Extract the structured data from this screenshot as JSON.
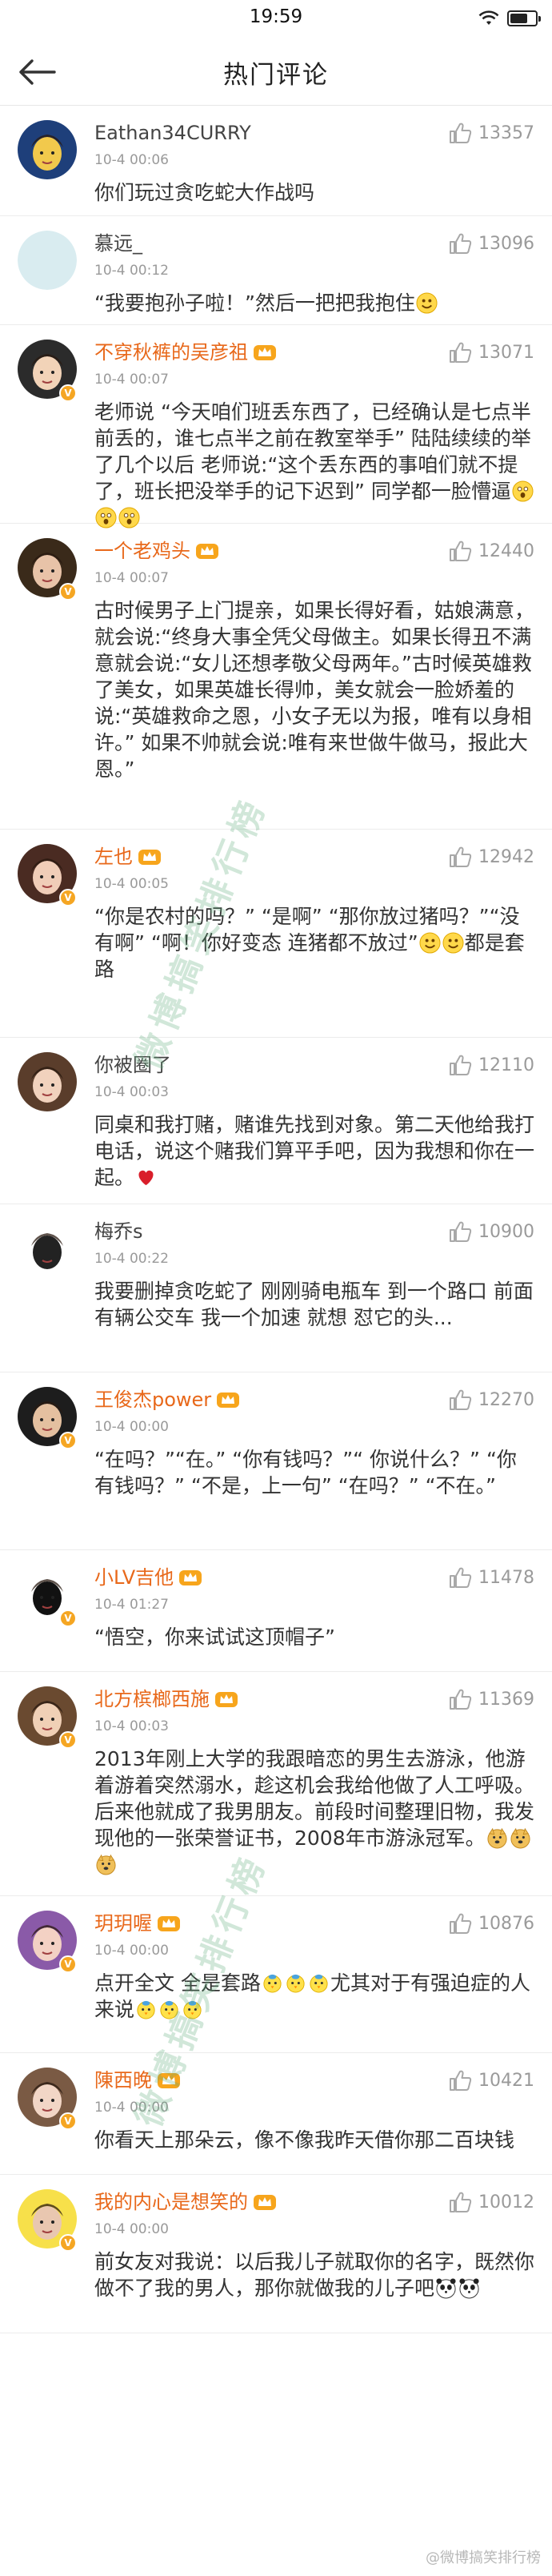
{
  "status_bar": {
    "time": "19:59",
    "battery_percent": 70
  },
  "nav": {
    "title": "热门评论"
  },
  "watermark": {
    "text": "微博搞笑排行榜"
  },
  "footer": {
    "watermark": "@微博搞笑排行榜"
  },
  "comments": [
    {
      "username": "Eathan34CURRY",
      "vip": false,
      "time": "10-4 00:06",
      "likes": "13357",
      "text": "你们玩过贪吃蛇大作战吗",
      "emoji_after": []
    },
    {
      "username": "慕远_",
      "vip": false,
      "time": "10-4 00:12",
      "likes": "13096",
      "text": "“我要抱孙子啦！”然后一把把我抱住",
      "emoji_after": [
        "smile"
      ]
    },
    {
      "username": "不穿秋裤的吴彦祖",
      "vip": true,
      "time": "10-4 00:07",
      "likes": "13071",
      "text": "老师说 “今天咱们班丢东西了，已经确认是七点半前丢的，谁七点半之前在教室举手” 陆陆续续的举了几个以后 老师说:“这个丢东西的事咱们就不提了，班长把没举手的记下迟到” 同学都一脸懵逼",
      "emoji_after": [
        "shock",
        "shock",
        "shock"
      ]
    },
    {
      "username": "一个老鸡头",
      "vip": true,
      "time": "10-4 00:07",
      "likes": "12440",
      "text": "古时候男子上门提亲，如果长得好看，姑娘满意，就会说:“终身大事全凭父母做主。如果长得丑不满意就会说:“女儿还想孝敬父母两年。”古时候英雄救了美女，如果英雄长得帅，美女就会一脸娇羞的说:“英雄救命之恩，小女子无以为报，唯有以身相许。” 如果不帅就会说:唯有来世做牛做马，报此大恩。”",
      "emoji_after": []
    },
    {
      "username": "左也",
      "vip": true,
      "time": "10-4 00:05",
      "likes": "12942",
      "text": "“你是农村的吗？” “是啊” “那你放过猪吗？”“没有啊” “啊！你好变态 连猪都不放过”",
      "emoji_after": [
        "smile",
        "smile"
      ],
      "text_after": "都是套路"
    },
    {
      "username": "你被圈了",
      "vip": false,
      "time": "10-4 00:03",
      "likes": "12110",
      "text": "同桌和我打赌，赌谁先找到对象。第二天他给我打电话，说这个赌我们算平手吧，因为我想和你在一起。",
      "emoji_after": [
        "heart"
      ]
    },
    {
      "username": "梅乔s",
      "vip": false,
      "time": "10-4 00:22",
      "likes": "10900",
      "text": "我要删掉贪吃蛇了 刚刚骑电瓶车 到一个路口 前面有辆公交车 我一个加速 就想 怼它的头...",
      "emoji_after": []
    },
    {
      "username": "王俊杰power",
      "vip": true,
      "time": "10-4 00:00",
      "likes": "12270",
      "text": "“在吗？”“在。” “你有钱吗？”“ 你说什么？” “你有钱吗？” “不是，上一句” “在吗？” “不在。”",
      "emoji_after": []
    },
    {
      "username": "小LV吉他",
      "vip": true,
      "time": "10-4 01:27",
      "likes": "11478",
      "text": "“悟空，你来试试这顶帽子”",
      "emoji_after": []
    },
    {
      "username": "北方槟榔西施",
      "vip": true,
      "time": "10-4 00:03",
      "likes": "11369",
      "text": "2013年刚上大学的我跟暗恋的男生去游泳，他游着游着突然溺水，趁这机会我给他做了人工呼吸。后来他就成了我男朋友。前段时间整理旧物，我发现他的一张荣誉证书，2008年市游泳冠军。",
      "emoji_after": [
        "doge",
        "doge",
        "doge"
      ]
    },
    {
      "username": "玥玥喔",
      "vip": true,
      "time": "10-4 00:00",
      "likes": "10876",
      "text": "点开全文 全是套路",
      "emoji_after": [
        "chick",
        "chick",
        "chick"
      ],
      "text_after": "尤其对于有强迫症的人来说",
      "emoji_after2": [
        "chick",
        "chick",
        "chick"
      ]
    },
    {
      "username": "陳西晚",
      "vip": true,
      "time": "10-4 00:00",
      "likes": "10421",
      "text": "你看天上那朵云，像不像我昨天借你那二百块钱",
      "emoji_after": []
    },
    {
      "username": "我的内心是想笑的",
      "vip": true,
      "time": "10-4 00:00",
      "likes": "10012",
      "text": "前女友对我说：以后我儿子就取你的名字，既然你做不了我的男人，那你就做我的儿子吧",
      "emoji_after": [
        "panda",
        "panda"
      ]
    }
  ]
}
